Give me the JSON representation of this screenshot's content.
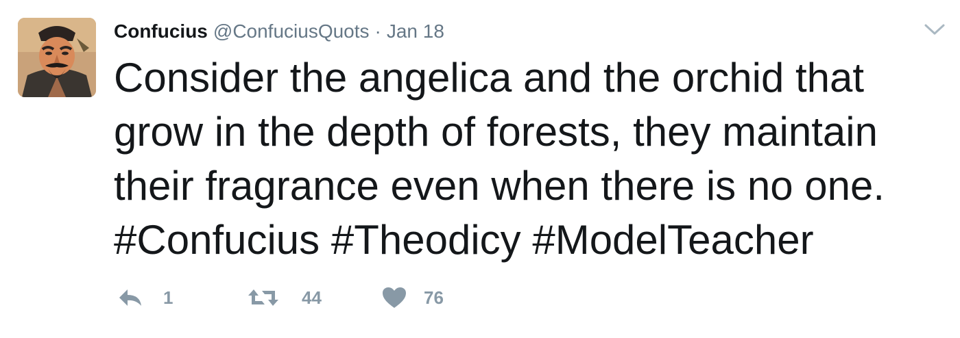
{
  "tweet": {
    "author": {
      "name": "Confucius",
      "handle": "@ConfuciusQuots"
    },
    "separator": "·",
    "date": "Jan 18",
    "text_lines": [
      "Consider the angelica and the orchid that",
      "grow in the depth of forests, they maintain",
      "their fragrance even when there is no one.",
      "#Confucius #Theodicy #ModelTeacher"
    ],
    "actions": {
      "reply": {
        "icon": "reply-icon",
        "count": "1"
      },
      "retweet": {
        "icon": "retweet-icon",
        "count": "44"
      },
      "like": {
        "icon": "heart-icon",
        "count": "76"
      }
    },
    "colors": {
      "text": "#14171a",
      "secondary": "#657786",
      "action": "#8899a6"
    }
  }
}
